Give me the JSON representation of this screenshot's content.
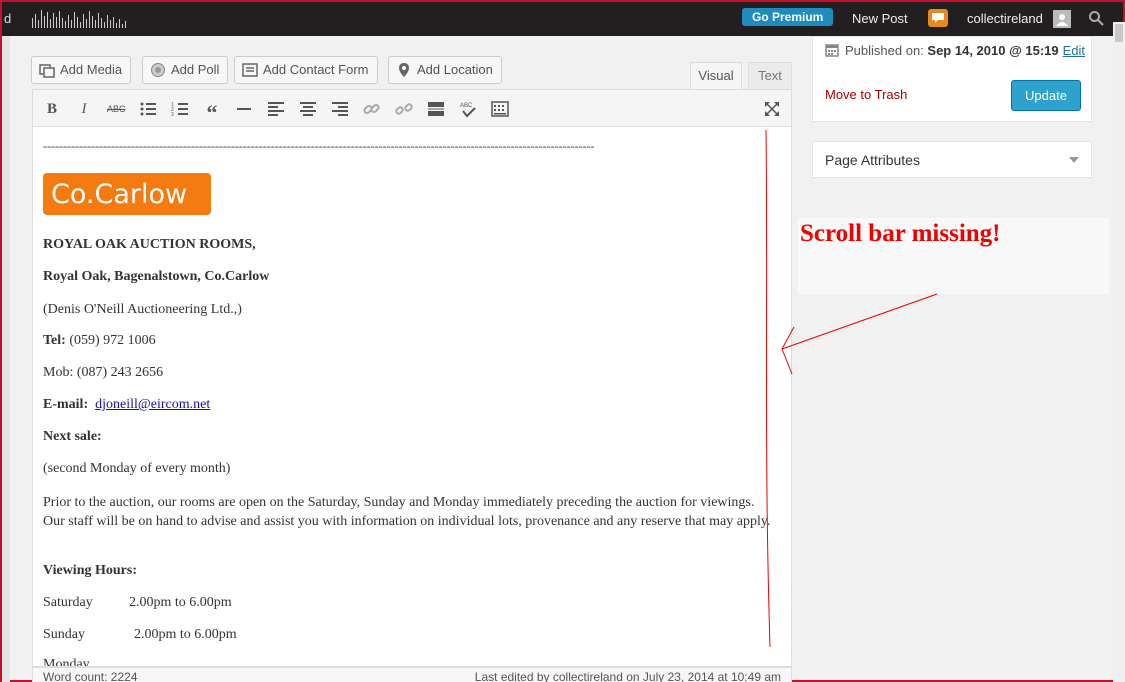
{
  "adminbar": {
    "left_text": "d",
    "premium_label": "Go Premium",
    "new_post_label": "New Post",
    "username": "collectireland"
  },
  "media_buttons": [
    {
      "label": "Add Media",
      "icon": "media-icon"
    },
    {
      "label": "Add Poll",
      "icon": "poll-icon"
    },
    {
      "label": "Add Contact Form",
      "icon": "form-icon"
    },
    {
      "label": "Add Location",
      "icon": "location-icon"
    }
  ],
  "editor_tabs": {
    "visual": "Visual",
    "text": "Text"
  },
  "toolbar_icons": [
    "bold-icon",
    "italic-icon",
    "strikethrough-icon",
    "bullet-list-icon",
    "numbered-list-icon",
    "blockquote-icon",
    "horizontal-rule-icon",
    "align-left-icon",
    "align-center-icon",
    "align-right-icon",
    "link-icon",
    "unlink-icon",
    "read-more-icon",
    "spellcheck-icon",
    "kitchen-sink-icon",
    "fullscreen-icon"
  ],
  "content": {
    "dash_line": "------------------------------------------------------------------------------------------------------------------------------------------",
    "logo_text": "Co.Carlow",
    "line1": "ROYAL OAK AUCTION ROOMS,",
    "line2": "Royal Oak, Bagenalstown, Co.Carlow",
    "line3": "(Denis O'Neill Auctioneering Ltd.,)",
    "tel_label": "Tel:",
    "tel_value": " (059) 972 1006",
    "mob": "Mob: (087) 243 2656",
    "email_label": "E-mail:",
    "email_value": "djoneill@eircom.net",
    "next_sale": "Next sale:",
    "second_monday": "(second Monday of every month)",
    "prior_text": "Prior to the auction, our rooms are open on the Saturday, Sunday and Monday immediately preceding the auction for viewings. Our staff will be on hand to advise and assist you with information on individual lots, provenance and any reserve that may apply.",
    "viewing_hours": "Viewing Hours:",
    "saturday": "Saturday",
    "saturday_time": "2.00pm to 6.00pm",
    "sunday": "Sunday",
    "sunday_time": "2.00pm to 6.00pm",
    "cut_line": "Monday"
  },
  "statusbar": {
    "word_count": "Word count: 2224",
    "last_edited": "Last edited by collectireland on July 23, 2014 at 10:49 am"
  },
  "publish": {
    "published_label": "Published on:",
    "published_date": "Sep 14, 2010 @ 15:19",
    "edit_link": "Edit",
    "trash_label": "Move to Trash",
    "update_label": "Update"
  },
  "page_attributes": {
    "title": "Page Attributes"
  },
  "annotation": {
    "text": "Scroll bar missing!",
    "color": "#e00000"
  },
  "colors": {
    "accent": "#2ea2cc",
    "adminbar": "#231f20",
    "logo": "#f47b0f",
    "border_frame": "#c8102e"
  }
}
